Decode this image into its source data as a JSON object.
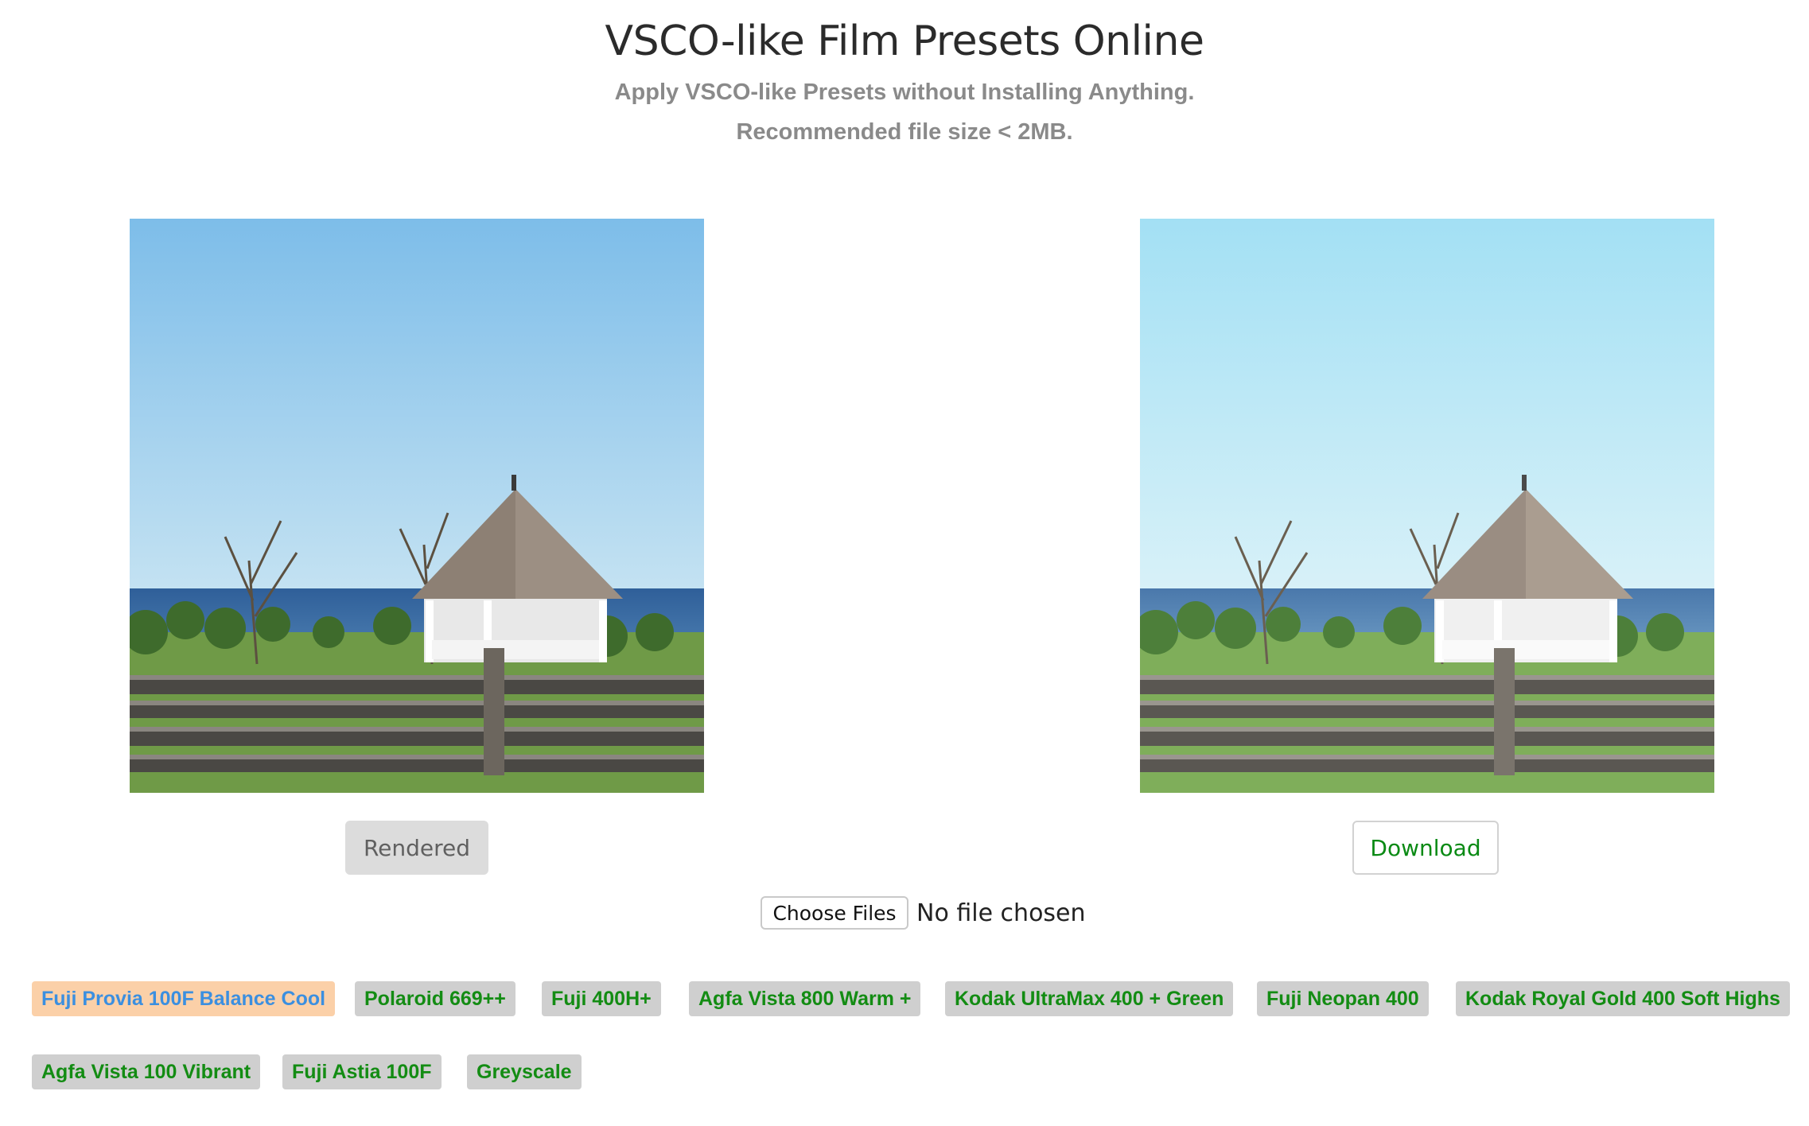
{
  "header": {
    "title": "VSCO-like Film Presets Online",
    "subtitle": "Apply VSCO-like Presets without Installing Anything.",
    "note": "Recommended file size < 2MB."
  },
  "images": {
    "original": {
      "alt": "Gazebo by the sea"
    },
    "filtered": {
      "alt": "Gazebo by the sea"
    }
  },
  "buttons": {
    "rendered_label": "Rendered",
    "download_label": "Download"
  },
  "file_input": {
    "button_label": "Choose Files",
    "status": "No file chosen"
  },
  "presets": [
    {
      "label": "Fuji Provia 100F Balance Cool",
      "active": true
    },
    {
      "label": "Polaroid 669++",
      "active": false
    },
    {
      "label": "Fuji 400H+",
      "active": false
    },
    {
      "label": "Agfa Vista 800 Warm +",
      "active": false
    },
    {
      "label": "Kodak UltraMax 400 + Green",
      "active": false
    },
    {
      "label": "Fuji Neopan 400",
      "active": false
    },
    {
      "label": "Kodak Royal Gold 400 Soft Highs",
      "active": false
    },
    {
      "label": "Agfa Vista 100 Vibrant",
      "active": false
    },
    {
      "label": "Fuji Astia 100F",
      "active": false
    },
    {
      "label": "Greyscale",
      "active": false
    }
  ],
  "colors": {
    "preset_text": "#138c13",
    "preset_bg": "#cfcfcf",
    "active_preset_bg": "#fbd0a8",
    "active_preset_text": "#3b8fe0",
    "download_text": "#0a8a14"
  }
}
